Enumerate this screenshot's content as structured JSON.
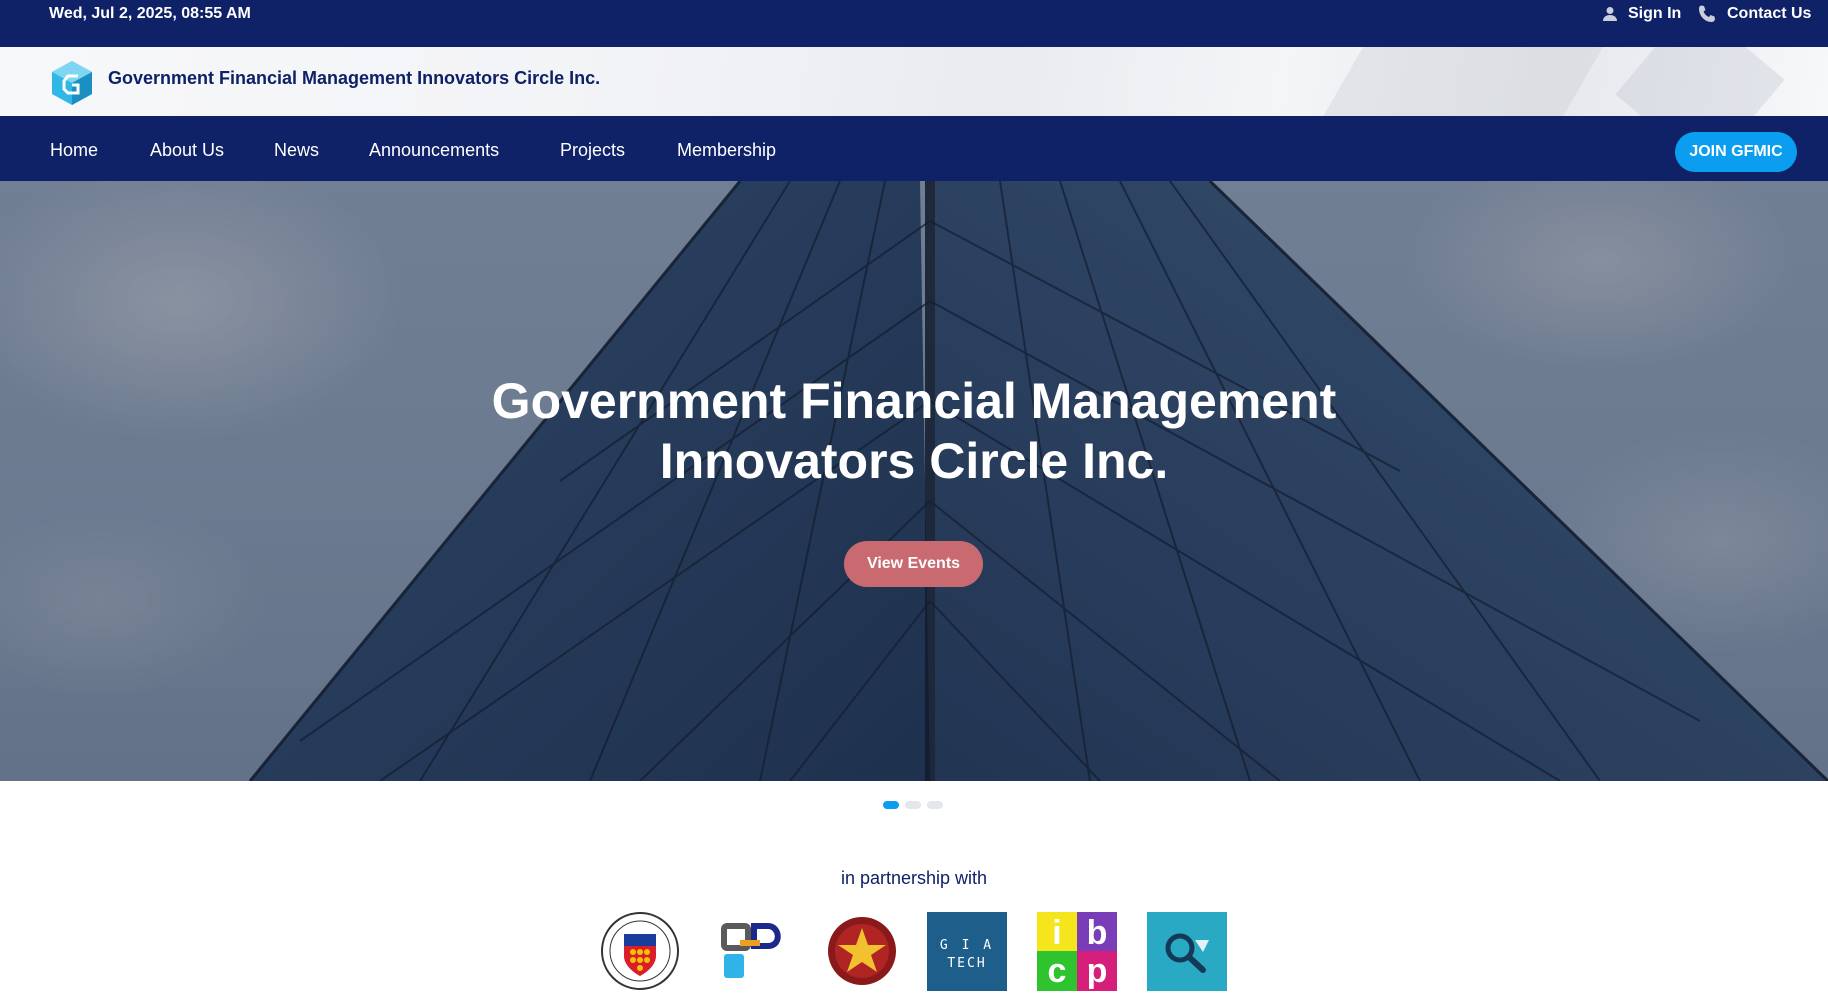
{
  "topbar": {
    "datetime": "Wed, Jul 2, 2025, 08:55 AM",
    "signin_label": "Sign In",
    "contact_label": "Contact Us"
  },
  "brand": {
    "name": "Government Financial Management Innovators Circle Inc."
  },
  "nav": {
    "items": [
      {
        "label": "Home"
      },
      {
        "label": "About Us"
      },
      {
        "label": "News"
      },
      {
        "label": "Announcements"
      },
      {
        "label": "Projects"
      },
      {
        "label": "Membership"
      }
    ],
    "join_label": "JOIN GFMIC"
  },
  "hero": {
    "title_line1": "Government Financial Management",
    "title_line2": "Innovators Circle Inc.",
    "button_label": "View Events"
  },
  "carousel": {
    "slide_count": 3,
    "active_index": 0
  },
  "partners": {
    "title": "in partnership with",
    "logos": [
      {
        "name": "commission-on-audit-seal",
        "text": "COMMISSION ON AUDIT · REPUBLIC OF THE PHILIPPINES"
      },
      {
        "name": "fdp-logo",
        "text": ""
      },
      {
        "name": "pup-seal",
        "text": ""
      },
      {
        "name": "gia-tech-logo",
        "text": "G I A TECH"
      },
      {
        "name": "ibcp-logo",
        "text": "i b c p"
      },
      {
        "name": "search-logo",
        "text": ""
      }
    ]
  },
  "colors": {
    "navy": "#0f2167",
    "accent_blue": "#0b9ef0",
    "events_button": "#c96a70"
  }
}
